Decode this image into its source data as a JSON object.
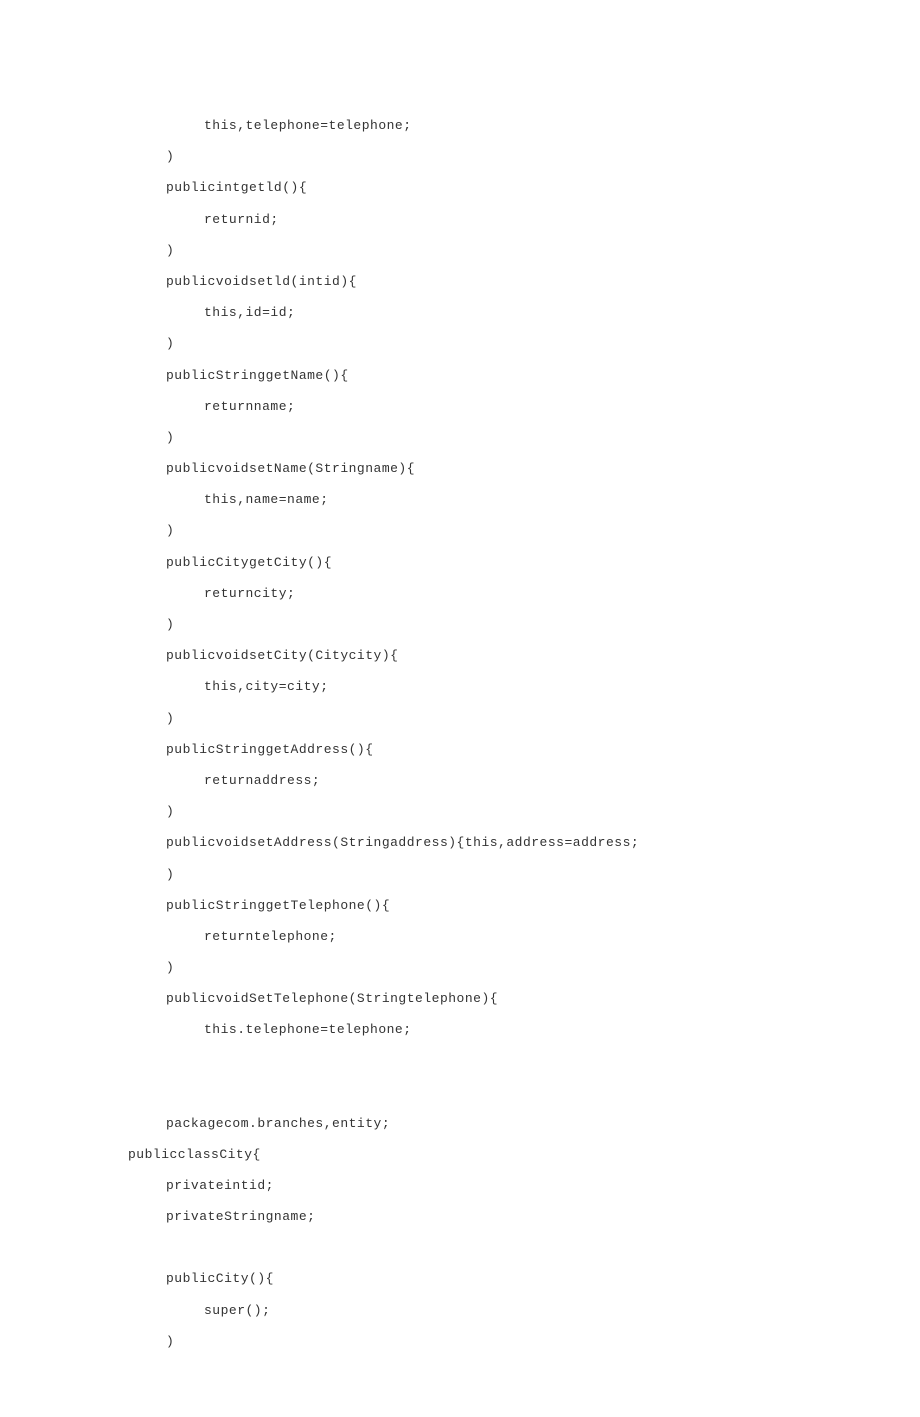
{
  "code": {
    "lines": [
      {
        "indent": 2,
        "text": "this,telephone=telephone;"
      },
      {
        "indent": 1,
        "text": ")"
      },
      {
        "indent": 1,
        "text": "publicintgetld(){"
      },
      {
        "indent": 2,
        "text": "returnid;"
      },
      {
        "indent": 1,
        "text": ")"
      },
      {
        "indent": 1,
        "text": "publicvoidsetld(intid){"
      },
      {
        "indent": 2,
        "text": "this,id=id;"
      },
      {
        "indent": 1,
        "text": ")"
      },
      {
        "indent": 1,
        "text": "publicStringgetName(){"
      },
      {
        "indent": 2,
        "text": "returnname;"
      },
      {
        "indent": 1,
        "text": ")"
      },
      {
        "indent": 1,
        "text": "publicvoidsetName(Stringname){"
      },
      {
        "indent": 2,
        "text": "this,name=name;"
      },
      {
        "indent": 1,
        "text": ")"
      },
      {
        "indent": 1,
        "text": "publicCitygetCity(){"
      },
      {
        "indent": 2,
        "text": "returncity;"
      },
      {
        "indent": 1,
        "text": ")"
      },
      {
        "indent": 1,
        "text": "publicvoidsetCity(Citycity){"
      },
      {
        "indent": 2,
        "text": "this,city=city;"
      },
      {
        "indent": 1,
        "text": ")"
      },
      {
        "indent": 1,
        "text": "publicStringgetAddress(){"
      },
      {
        "indent": 2,
        "text": "returnaddress;"
      },
      {
        "indent": 1,
        "text": ")"
      },
      {
        "indent": 1,
        "text": "publicvoidsetAddress(Stringaddress){this,address=address;"
      },
      {
        "indent": 1,
        "text": ")"
      },
      {
        "indent": 1,
        "text": "publicStringgetTelephone(){"
      },
      {
        "indent": 2,
        "text": "returntelephone;"
      },
      {
        "indent": 1,
        "text": ")"
      },
      {
        "indent": 1,
        "text": "publicvoidSetTelephone(Stringtelephone){"
      },
      {
        "indent": 2,
        "text": "this.telephone=telephone;"
      },
      {
        "indent": 0,
        "text": "",
        "blank": true
      },
      {
        "indent": 0,
        "text": "",
        "blank": true
      },
      {
        "indent": 1,
        "text": "packagecom.branches,entity;"
      },
      {
        "indent": 0,
        "text": "publicclassCity{"
      },
      {
        "indent": 1,
        "text": "privateintid;"
      },
      {
        "indent": 1,
        "text": "privateStringname;"
      },
      {
        "indent": 0,
        "text": "",
        "blank": true
      },
      {
        "indent": 1,
        "text": "publicCity(){"
      },
      {
        "indent": 2,
        "text": "super();"
      },
      {
        "indent": 1,
        "text": ")"
      }
    ]
  }
}
